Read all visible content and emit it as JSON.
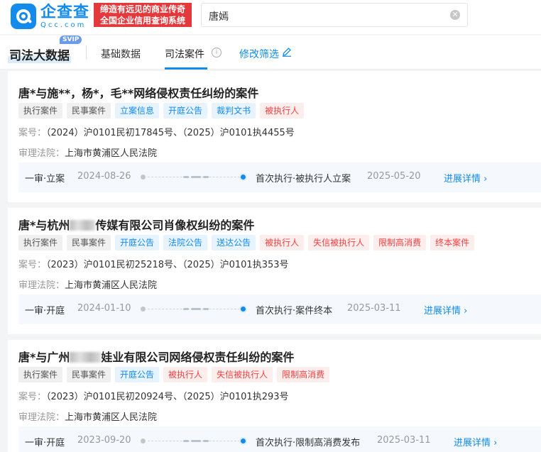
{
  "header": {
    "logo_cn": "企查查",
    "logo_en": "Qcc.com",
    "slogan_line1": "缔造有远见的商业传奇",
    "slogan_line2": "全国企业信用查询系统",
    "search_value": "唐嫣"
  },
  "tabbar": {
    "brand": "司法大数据",
    "badge": "SVIP",
    "tabs": [
      {
        "label": "基础数据"
      },
      {
        "label": "司法案件",
        "active": true
      }
    ],
    "filter_label": "修改筛选"
  },
  "labels": {
    "case_no": "案号：",
    "court": "审理法院：",
    "details": "进展详情"
  },
  "cases": [
    {
      "title": "唐*与施**，杨*，毛**网络侵权责任纠纷的案件",
      "tags": [
        {
          "text": "执行案件",
          "tone": "gray"
        },
        {
          "text": "民事案件",
          "tone": "gray"
        },
        {
          "text": "立案信息",
          "tone": "blue"
        },
        {
          "text": "开庭公告",
          "tone": "blue"
        },
        {
          "text": "裁判文书",
          "tone": "blue"
        },
        {
          "text": "被执行人",
          "tone": "red"
        }
      ],
      "case_no": "（2024）沪0101民初17845号、（2025）沪0101执4455号",
      "court": "上海市黄浦区人民法院",
      "stage_start": "一审·立案",
      "date_start": "2024-08-26",
      "stage_end": "首次执行·被执行人立案",
      "date_end": "2025-05-20"
    },
    {
      "title_prefix": "唐*与杭州",
      "title_suffix": "传媒有限公司肖像权纠纷的案件",
      "tags": [
        {
          "text": "执行案件",
          "tone": "gray"
        },
        {
          "text": "民事案件",
          "tone": "gray"
        },
        {
          "text": "开庭公告",
          "tone": "blue"
        },
        {
          "text": "法院公告",
          "tone": "blue"
        },
        {
          "text": "送达公告",
          "tone": "blue"
        },
        {
          "text": "被执行人",
          "tone": "red"
        },
        {
          "text": "失信被执行人",
          "tone": "red"
        },
        {
          "text": "限制高消费",
          "tone": "red"
        },
        {
          "text": "终本案件",
          "tone": "red"
        }
      ],
      "case_no": "（2023）沪0101民初25218号、（2025）沪0101执353号",
      "court": "上海市黄浦区人民法院",
      "stage_start": "一审·开庭",
      "date_start": "2024-01-10",
      "stage_end": "首次执行·案件终本",
      "date_end": "2025-03-11"
    },
    {
      "title_prefix": "唐*与广州",
      "title_suffix": "娃业有限公司网络侵权责任纠纷的案件",
      "tags": [
        {
          "text": "执行案件",
          "tone": "gray"
        },
        {
          "text": "民事案件",
          "tone": "gray"
        },
        {
          "text": "开庭公告",
          "tone": "blue"
        },
        {
          "text": "被执行人",
          "tone": "red"
        },
        {
          "text": "失信被执行人",
          "tone": "red"
        },
        {
          "text": "限制高消费",
          "tone": "red"
        }
      ],
      "case_no": "（2023）沪0101民初20924号、（2025）沪0101执293号",
      "court": "上海市黄浦区人民法院",
      "stage_start": "一审·开庭",
      "date_start": "2023-09-20",
      "stage_end": "首次执行·限制高消费发布",
      "date_end": "2025-03-11"
    }
  ],
  "colors": {
    "brand_blue": "#128bed",
    "slogan_red": "#e4393c",
    "tag_red": "#f04040"
  }
}
